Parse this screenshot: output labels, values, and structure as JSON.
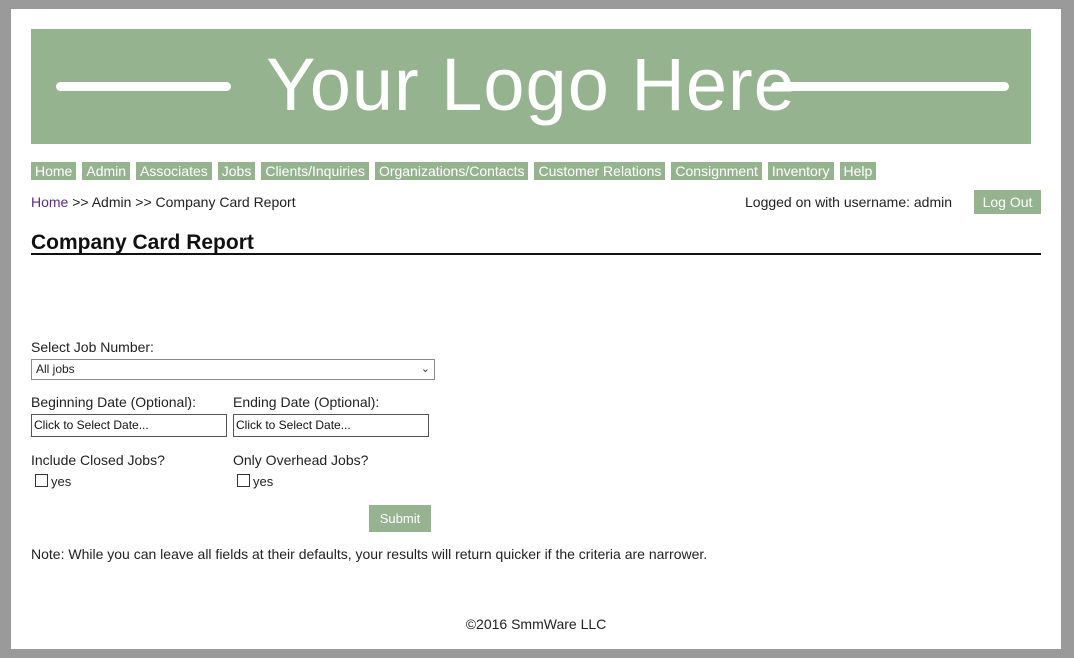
{
  "logo": {
    "text": "Your Logo Here"
  },
  "nav": {
    "items": [
      "Home",
      "Admin",
      "Associates",
      "Jobs",
      "Clients/Inquiries",
      "Organizations/Contacts",
      "Customer Relations",
      "Consignment",
      "Inventory",
      "Help"
    ]
  },
  "breadcrumb": {
    "home": "Home",
    "rest": " >> Admin >> Company Card Report"
  },
  "user": {
    "status": "Logged on with username: admin",
    "logout_label": "Log Out"
  },
  "page": {
    "title": "Company Card Report"
  },
  "form": {
    "job_label": "Select Job Number:",
    "job_value": "All jobs",
    "begin_label": "Beginning Date (Optional):",
    "begin_value": "Click to Select Date...",
    "end_label": "Ending Date (Optional):",
    "end_value": "Click to Select Date...",
    "closed_label": "Include Closed Jobs?",
    "closed_option": "yes",
    "overhead_label": "Only Overhead Jobs?",
    "overhead_option": "yes",
    "submit_label": "Submit"
  },
  "note": "Note: While you can leave all fields at their defaults, your results will return quicker if the criteria are narrower.",
  "footer": "©2016 SmmWare LLC",
  "colors": {
    "accent": "#96b38f",
    "link": "#5a2d82"
  }
}
